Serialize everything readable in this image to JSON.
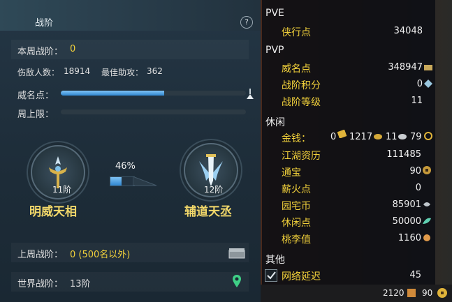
{
  "left": {
    "title": "战阶",
    "help": "?",
    "week_rank_label": "本周战阶：",
    "week_rank_value": "0",
    "kills_label": "伤敌人数：",
    "kills_value": "18914",
    "assist_label": "最佳助攻：",
    "assist_value": "362",
    "fame_label": "威名点：",
    "fame_progress": 0.56,
    "week_cap_label": "周上限：",
    "week_cap_progress": 0,
    "current": {
      "tier": "11阶",
      "name": "明威天相"
    },
    "progress_percent": "46%",
    "next": {
      "tier": "12阶",
      "name": "辅道天丞"
    },
    "last_week_label": "上周战阶：",
    "last_week_value": "0 (500名以外)",
    "world_label": "世界战阶：",
    "world_value": "13阶"
  },
  "right": {
    "pve_header": "PVE",
    "pve": [
      {
        "label": "侠行点",
        "value": "34048"
      }
    ],
    "pvp_header": "PVP",
    "pvp": [
      {
        "label": "威名点",
        "value": "348947"
      },
      {
        "label": "战阶积分",
        "value": "0"
      },
      {
        "label": "战阶等级",
        "value": "11"
      }
    ],
    "leisure_header": "休闲",
    "money_label": "金钱：",
    "money_values": [
      "0",
      "1217",
      "11",
      "79"
    ],
    "leisure": [
      {
        "label": "江湖资历",
        "value": "111485"
      },
      {
        "label": "通宝",
        "value": "90"
      },
      {
        "label": "薪火点",
        "value": "0"
      },
      {
        "label": "园宅币",
        "value": "85901"
      },
      {
        "label": "休闲点",
        "value": "50000"
      },
      {
        "label": "桃李值",
        "value": "1160"
      }
    ],
    "other_header": "其他",
    "latency_label": "网络延迟",
    "latency_value": "45",
    "footer_left": "2120",
    "footer_right": "90"
  }
}
